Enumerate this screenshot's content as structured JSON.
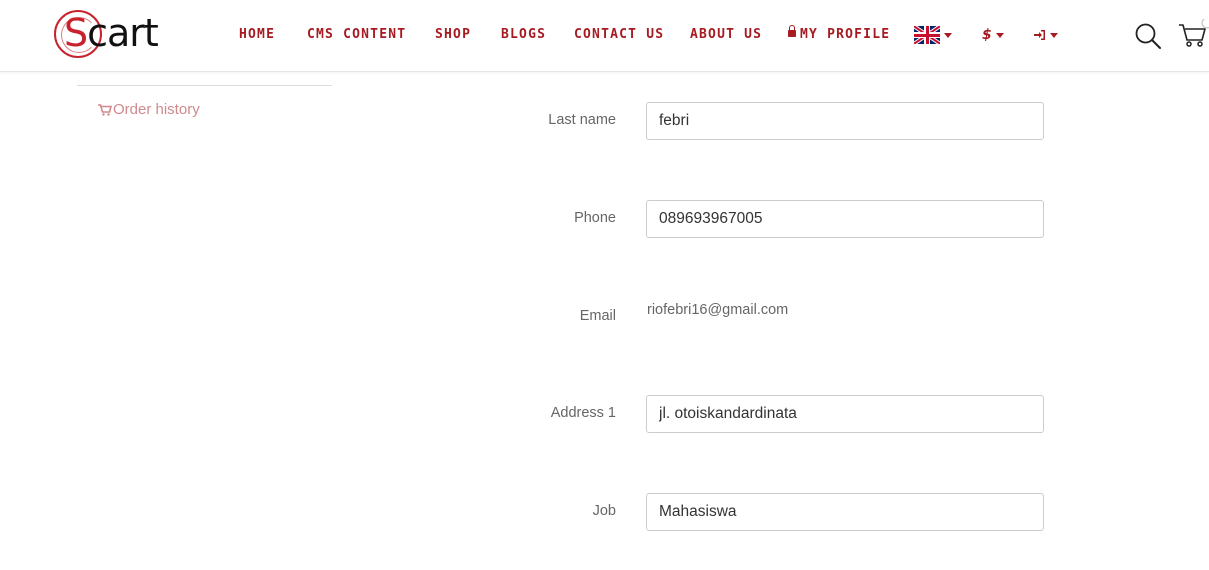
{
  "brand": {
    "logo_letter": "S",
    "logo_rest": "cart"
  },
  "nav": {
    "items": [
      {
        "label": "HOME"
      },
      {
        "label": "CMS CONTENT"
      },
      {
        "label": "SHOP"
      },
      {
        "label": "BLOGS"
      },
      {
        "label": "CONTACT US"
      },
      {
        "label": "ABOUT US"
      },
      {
        "label": "MY PROFILE"
      }
    ],
    "currency_symbol": "$"
  },
  "icons": {
    "language": "uk-flag-icon",
    "signin": "sign-in-icon",
    "search": "search-icon",
    "cart": "cart-icon",
    "lock": "lock-icon",
    "order_history": "cart-icon"
  },
  "sidebar": {
    "order_history_label": "Order history"
  },
  "form": {
    "last_name": {
      "label": "Last name",
      "value": "febri"
    },
    "phone": {
      "label": "Phone",
      "value": "089693967005"
    },
    "email": {
      "label": "Email",
      "value": "riofebri16@gmail.com"
    },
    "address1": {
      "label": "Address 1",
      "value": "jl. otoiskandardinata"
    },
    "job": {
      "label": "Job",
      "value": "Mahasiswa"
    }
  },
  "colors": {
    "accent": "#a61b22",
    "link_muted": "#d08a8e"
  }
}
